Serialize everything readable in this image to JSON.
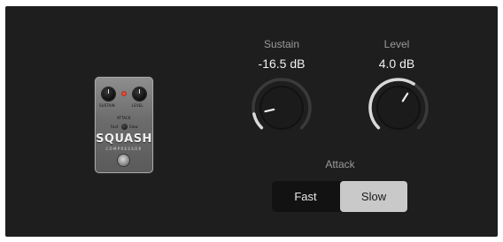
{
  "pedal": {
    "left_knob_label": "SUSTAIN",
    "right_knob_label": "LEVEL",
    "attack_label": "ATTACK",
    "fast_label": "Fast",
    "slow_label": "Slow",
    "brand": "SQUASH",
    "subtitle": "COMPRESSOR"
  },
  "sustain": {
    "label": "Sustain",
    "value_text": "-16.5 dB",
    "level": 0.12
  },
  "level": {
    "label": "Level",
    "value_text": "4.0 dB",
    "level": 0.62
  },
  "attack": {
    "label": "Attack",
    "options": [
      "Fast",
      "Slow"
    ],
    "selected": "Slow"
  },
  "colors": {
    "panel": "#1e1e1f",
    "arc_track": "#3a3a3a",
    "arc_fill": "#d9d9d9",
    "segment_selected": "#c9c9c9"
  }
}
